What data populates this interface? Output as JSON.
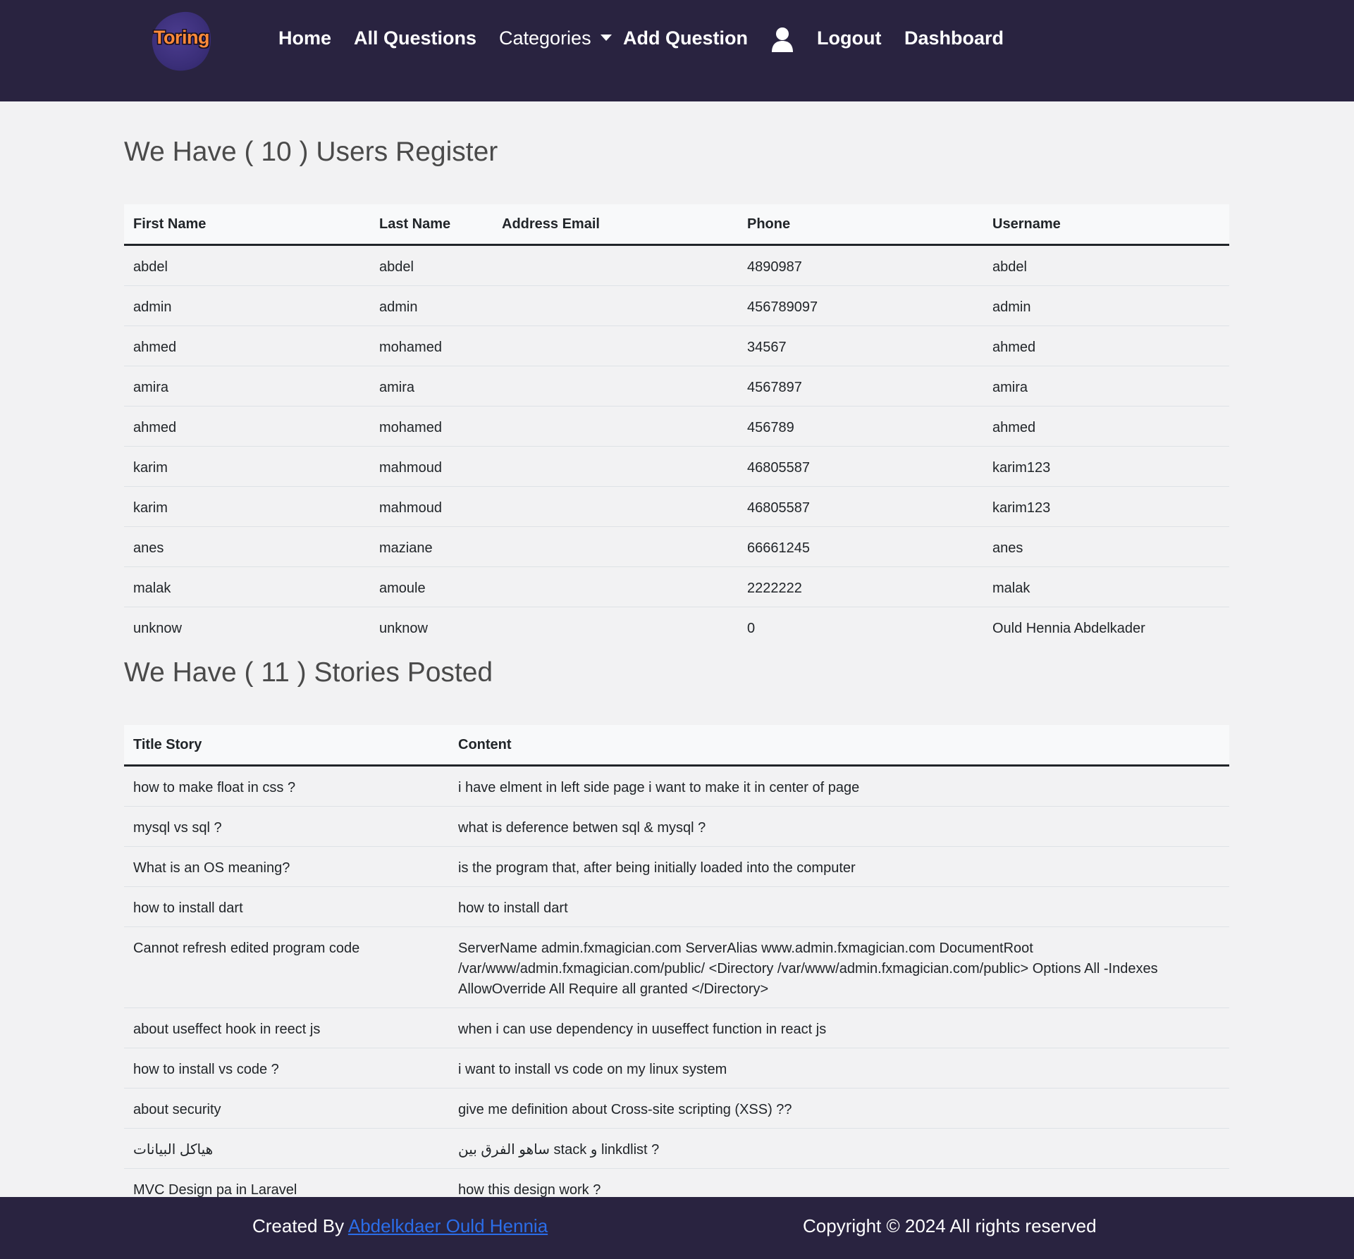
{
  "nav": {
    "logo_text": "Toring",
    "home": "Home",
    "all_questions": "All Questions",
    "categories": "Categories",
    "add_question": "Add Question",
    "logout": "Logout",
    "dashboard": "Dashboard",
    "user_icon": "user-icon"
  },
  "users": {
    "title": "We Have ( 10 ) Users Register",
    "headers": [
      "First Name",
      "Last Name",
      "Address Email",
      "Phone",
      "Username"
    ],
    "rows": [
      [
        "abdel",
        "abdel",
        "",
        "4890987",
        "abdel"
      ],
      [
        "admin",
        "admin",
        "",
        "456789097",
        "admin"
      ],
      [
        "ahmed",
        "mohamed",
        "",
        "34567",
        "ahmed"
      ],
      [
        "amira",
        "amira",
        "",
        "4567897",
        "amira"
      ],
      [
        "ahmed",
        "mohamed",
        "",
        "456789",
        "ahmed"
      ],
      [
        "karim",
        "mahmoud",
        "",
        "46805587",
        "karim123"
      ],
      [
        "karim",
        "mahmoud",
        "",
        "46805587",
        "karim123"
      ],
      [
        "anes",
        "maziane",
        "",
        "66661245",
        "anes"
      ],
      [
        "malak",
        "amoule",
        "",
        "2222222",
        "malak"
      ],
      [
        "unknow",
        "unknow",
        "",
        "0",
        "Ould Hennia Abdelkader"
      ]
    ]
  },
  "stories": {
    "title": "We Have ( 11 ) Stories Posted",
    "headers": [
      "Title Story",
      "Content"
    ],
    "rows": [
      [
        "how to make float in css ?",
        "i have elment in left side page i want to make it in center of page"
      ],
      [
        "mysql vs sql ?",
        "what is deference betwen sql & mysql ?"
      ],
      [
        "What is an OS meaning?",
        "is the program that, after being initially loaded into the computer"
      ],
      [
        "how to install dart",
        "how to install dart"
      ],
      [
        "Cannot refresh edited program code",
        "ServerName admin.fxmagician.com ServerAlias www.admin.fxmagician.com DocumentRoot /var/www/admin.fxmagician.com/public/ <Directory /var/www/admin.fxmagician.com/public> Options All -Indexes AllowOverride All Require all granted </Directory>"
      ],
      [
        "about useffect hook in reect js",
        "when i can use dependency in uuseffect function in react js"
      ],
      [
        "how to install vs code ?",
        "i want to install vs code on my linux system"
      ],
      [
        "about security",
        "give me definition about Cross-site scripting (XSS) ??"
      ],
      [
        "هياكل البيانات",
        "ساهو الفرق بين stack و linkdlist ?"
      ],
      [
        "MVC Design pa in Laravel",
        "how this design work ?"
      ]
    ]
  },
  "footer": {
    "created_by": "Created By ",
    "author": "Abdelkdaer Ould Hennia",
    "copyright": "Copyright © 2024 All rights reserved"
  },
  "colors": {
    "navbar_bg": "#292340",
    "page_bg": "#f2f2f3",
    "logo_text": "#ff8a3a",
    "link": "#2b6de8"
  }
}
